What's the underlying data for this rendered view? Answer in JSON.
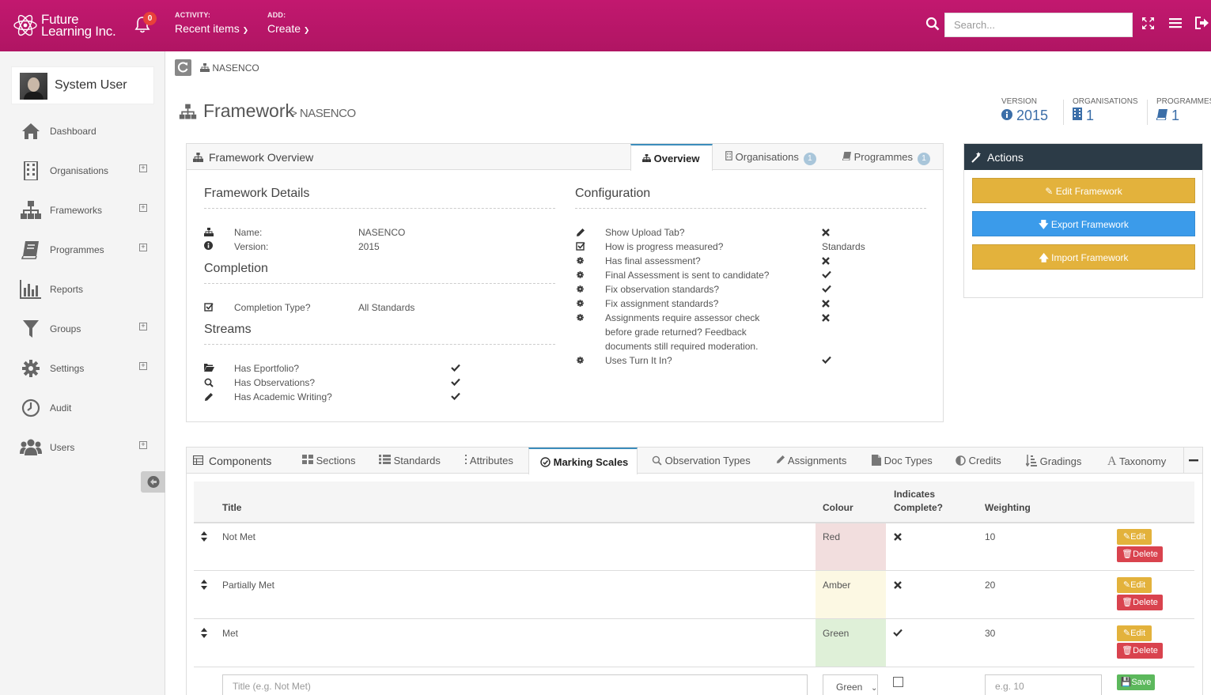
{
  "brand": {
    "line1": "Future",
    "line2": "Learning Inc."
  },
  "notifications": {
    "count": "0"
  },
  "topmenu": [
    {
      "label": "ACTIVITY:",
      "value": "Recent items"
    },
    {
      "label": "ADD:",
      "value": "Create"
    }
  ],
  "search": {
    "placeholder": "Search..."
  },
  "user": {
    "name": "System User"
  },
  "sidebar": {
    "items": [
      {
        "label": "Dashboard",
        "icon": "home-icon",
        "expand": false
      },
      {
        "label": "Organisations",
        "icon": "building-icon",
        "expand": true
      },
      {
        "label": "Frameworks",
        "icon": "sitemap-icon",
        "expand": true
      },
      {
        "label": "Programmes",
        "icon": "book-icon",
        "expand": true
      },
      {
        "label": "Reports",
        "icon": "bar-chart-icon",
        "expand": false
      },
      {
        "label": "Groups",
        "icon": "filter-icon",
        "expand": true
      },
      {
        "label": "Settings",
        "icon": "gear-icon",
        "expand": true
      },
      {
        "label": "Audit",
        "icon": "clock-icon",
        "expand": false
      },
      {
        "label": "Users",
        "icon": "users-icon",
        "expand": true
      }
    ]
  },
  "breadcrumb": {
    "current": "NASENCO"
  },
  "page": {
    "title": "Framework",
    "subtitle": "> NASENCO"
  },
  "stats": [
    {
      "label": "VERSION",
      "value": "2015"
    },
    {
      "label": "ORGANISATIONS",
      "value": "1"
    },
    {
      "label": "PROGRAMMES",
      "value": "1"
    }
  ],
  "overview": {
    "title": "Framework Overview",
    "tabs": [
      {
        "label": "Overview",
        "badge": ""
      },
      {
        "label": "Organisations",
        "badge": "1"
      },
      {
        "label": "Programmes",
        "badge": "1"
      }
    ],
    "details": {
      "title": "Framework Details",
      "rows": [
        {
          "label": "Name:",
          "value": "NASENCO"
        },
        {
          "label": "Version:",
          "value": "2015"
        }
      ]
    },
    "completion": {
      "title": "Completion",
      "rows": [
        {
          "label": "Completion Type?",
          "value": "All Standards"
        }
      ]
    },
    "streams": {
      "title": "Streams",
      "rows": [
        {
          "label": "Has Eportfolio?",
          "value": "yes"
        },
        {
          "label": "Has Observations?",
          "value": "yes"
        },
        {
          "label": "Has Academic Writing?",
          "value": "yes"
        }
      ]
    },
    "configuration": {
      "title": "Configuration",
      "rows": [
        {
          "label": "Show Upload Tab?",
          "value": "no"
        },
        {
          "label": "How is progress measured?",
          "value": "Standards"
        },
        {
          "label": "Has final assessment?",
          "value": "no"
        },
        {
          "label": "Final Assessment is sent to candidate?",
          "value": "yes"
        },
        {
          "label": "Fix observation standards?",
          "value": "yes"
        },
        {
          "label": "Fix assignment standards?",
          "value": "no"
        },
        {
          "label": "Assignments require assessor check",
          "line2": "before grade returned? Feedback",
          "line3": "documents still required moderation.",
          "value": "no"
        },
        {
          "label": "Uses Turn It In?",
          "value": "yes"
        }
      ]
    }
  },
  "actions": {
    "title": "Actions",
    "buttons": [
      {
        "label": "Edit Framework",
        "color": "#e3b23c"
      },
      {
        "label": "Export Framework",
        "color": "#3b9bea"
      },
      {
        "label": "Import Framework",
        "color": "#e3b23c"
      }
    ]
  },
  "components": {
    "title": "Components",
    "tabs": [
      "Sections",
      "Standards",
      "Attributes",
      "Marking Scales",
      "Observation Types",
      "Assignments",
      "Doc Types",
      "Credits",
      "Gradings",
      "Taxonomy"
    ],
    "active_tab": "Marking Scales",
    "table": {
      "headers": {
        "title": "Title",
        "colour": "Colour",
        "indicates1": "Indicates",
        "indicates2": "Complete?",
        "weighting": "Weighting"
      },
      "rows": [
        {
          "title": "Not Met",
          "colour": "Red",
          "bg": "#f2dede",
          "complete": "no",
          "weighting": "10"
        },
        {
          "title": "Partially Met",
          "colour": "Amber",
          "bg": "#fcf8e3",
          "complete": "no",
          "weighting": "20"
        },
        {
          "title": "Met",
          "colour": "Green",
          "bg": "#dff0d8",
          "complete": "yes",
          "weighting": "30"
        }
      ],
      "edit_label": "Edit",
      "delete_label": "Delete",
      "new_row": {
        "title_placeholder": "Title (e.g. Not Met)",
        "colour_value": "Green",
        "weighting_placeholder": "e.g. 10",
        "save_label": "Save"
      }
    }
  }
}
